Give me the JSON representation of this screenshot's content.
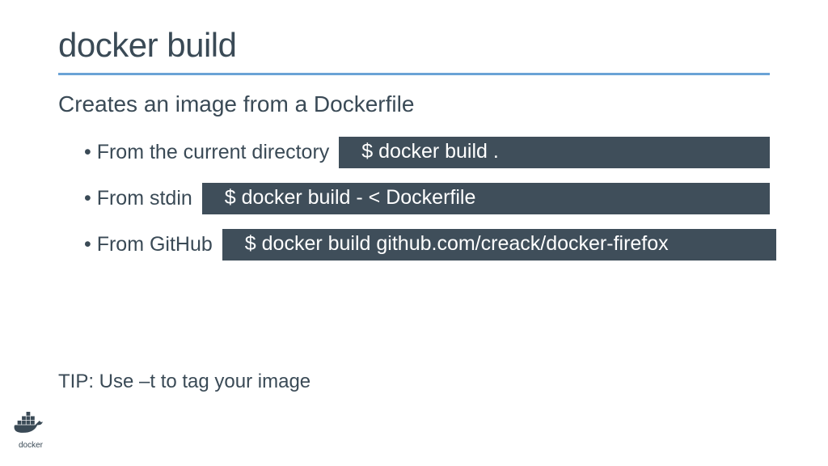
{
  "title": "docker build",
  "subtitle": "Creates an image from a Dockerfile",
  "bullets": [
    {
      "label": "From the current directory",
      "code": "$ docker build ."
    },
    {
      "label": "From stdin",
      "code": "$ docker build - < Dockerfile"
    },
    {
      "label": "From GitHub",
      "code": "$ docker build github.com/creack/docker-firefox"
    }
  ],
  "tip": "TIP: Use –t to tag your image",
  "logo_text": "docker"
}
